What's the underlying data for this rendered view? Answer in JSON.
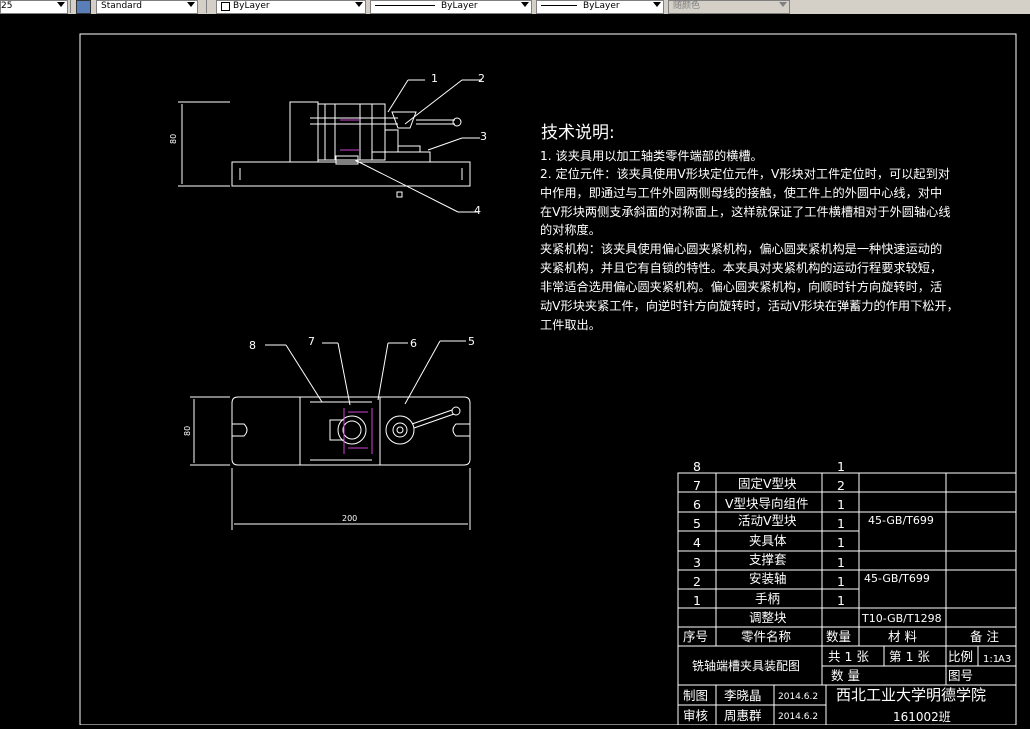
{
  "toolbar": {
    "layer_value": "25",
    "textstyle_value": "Standard",
    "color_value": "ByLayer",
    "linetype_value": "ByLayer",
    "lineweight_value": "ByLayer",
    "plotstyle_value": "随颜色"
  },
  "tech": {
    "title": "技术说明:",
    "lines": [
      "1. 该夹具用以加工轴类零件端部的横槽。",
      "2. 定位元件：该夹具使用V形块定位元件，V形块对工件定位时，可以起到对",
      "中作用，即通过与工件外圆两侧母线的接触，使工件上的外圆中心线，对中",
      "在V形块两侧支承斜面的对称面上，这样就保证了工件横槽相对于外圆轴心线",
      "的对称度。",
      "夹紧机构：该夹具使用偏心圆夹紧机构，偏心圆夹紧机构是一种快速运动的",
      "夹紧机构，并且它有自锁的特性。本夹具对夹紧机构的运动行程要求较短，",
      "非常适合选用偏心圆夹紧机构。偏心圆夹紧机构，向顺时针方向旋转时，活",
      "动V形块夹紧工件，向逆时针方向旋转时，活动V形块在弹蓄力的作用下松开，",
      "工件取出。"
    ]
  },
  "dims": {
    "height": "80",
    "width": "200",
    "depth": "80"
  },
  "callouts": {
    "c1": "1",
    "c2": "2",
    "c3": "3",
    "c4": "4",
    "c5": "5",
    "c6": "6",
    "c7": "7",
    "c8": "8"
  },
  "bom": {
    "rows": [
      {
        "no": "8",
        "name": "",
        "qty": "1",
        "mat": ""
      },
      {
        "no": "7",
        "name": "固定V型块",
        "qty": "2",
        "mat": ""
      },
      {
        "no": "6",
        "name": "V型块导向组件",
        "qty": "1",
        "mat": ""
      },
      {
        "no": "5",
        "name": "活动V型块",
        "qty": "1",
        "mat": "45-GB/T699"
      },
      {
        "no": "4",
        "name": "夹具体",
        "qty": "1",
        "mat": ""
      },
      {
        "no": "3",
        "name": "支撑套",
        "qty": "1",
        "mat": ""
      },
      {
        "no": "2",
        "name": "安装轴",
        "qty": "1",
        "mat": "45-GB/T699"
      },
      {
        "no": "1",
        "name": "手柄",
        "qty": "1",
        "mat": ""
      },
      {
        "no": "",
        "name": "调整块",
        "qty": "",
        "mat": "T10-GB/T1298"
      }
    ],
    "header": {
      "no": "序号",
      "name": "零件名称",
      "qty": "数量",
      "mat": "材 料",
      "note": "备 注"
    }
  },
  "title_block": {
    "drawing_name": "铣轴端槽夹具装配图",
    "total": "共 1 张",
    "sheet": "第 1 张",
    "scale_label": "比例",
    "scale_value": "1:1",
    "size": "A3",
    "qty_label": "数 量",
    "drawing_no_label": "图号",
    "drawn_label": "制图",
    "drawn_by": "李晓晶",
    "drawn_date": "2014.6.2",
    "checked_label": "审核",
    "checked_by": "周惠群",
    "checked_date": "2014.6.2",
    "school": "西北工业大学明德学院",
    "class": "161002班"
  },
  "colors": {
    "frame": "#ffffff",
    "highlight": "#cc44cc",
    "bg": "#000000"
  }
}
